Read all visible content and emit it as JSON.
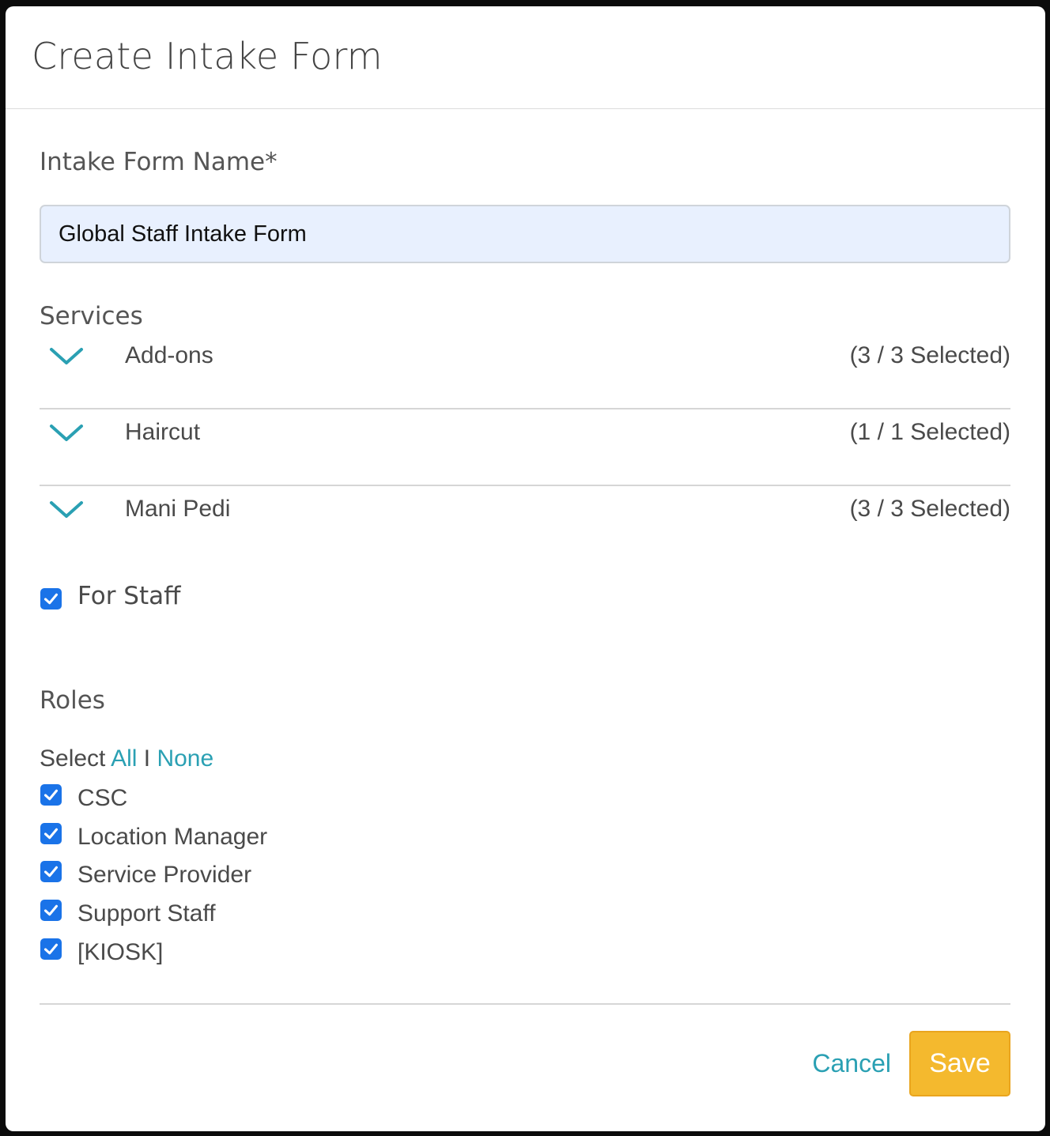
{
  "dialog": {
    "title": "Create Intake Form"
  },
  "name_field": {
    "label": "Intake Form Name*",
    "value": "Global Staff Intake Form"
  },
  "services": {
    "label": "Services",
    "items": [
      {
        "name": "Add-ons",
        "count": "(3 / 3 Selected)"
      },
      {
        "name": "Haircut",
        "count": "(1 / 1 Selected)"
      },
      {
        "name": "Mani Pedi",
        "count": "(3 / 3 Selected)"
      }
    ]
  },
  "for_staff": {
    "label": "For Staff",
    "checked": true
  },
  "roles": {
    "label": "Roles",
    "select_prefix": "Select",
    "select_all": "All",
    "separator": "I",
    "select_none": "None",
    "items": [
      {
        "label": "CSC",
        "checked": true
      },
      {
        "label": "Location Manager",
        "checked": true
      },
      {
        "label": "Service Provider",
        "checked": true
      },
      {
        "label": "Support Staff",
        "checked": true
      },
      {
        "label": "[KIOSK]",
        "checked": true
      }
    ]
  },
  "footer": {
    "cancel_label": "Cancel",
    "save_label": "Save"
  },
  "colors": {
    "accent": "#2aa0b3",
    "checkbox": "#1a73e8",
    "save_button": "#f4b92e",
    "input_bg": "#e8f0fe"
  }
}
